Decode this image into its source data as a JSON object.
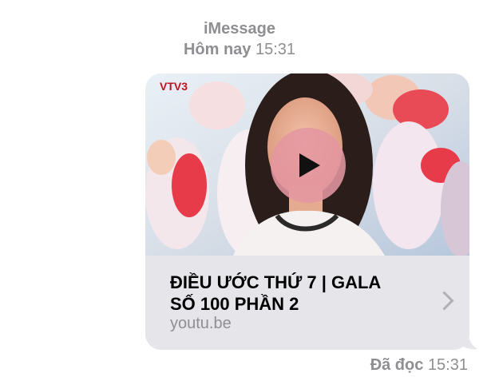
{
  "header": {
    "service": "iMessage",
    "day": "Hôm nay",
    "time": "15:31"
  },
  "link_preview": {
    "channel_logo": "VTV3",
    "title_line1": "ĐIỀU ƯỚC THỨ 7 | GALA",
    "title_line2": "SỐ 100 PHẦN 2",
    "domain": "youtu.be",
    "play_icon": "play-icon",
    "chevron_icon": "chevron-right-icon"
  },
  "receipt": {
    "status": "Đã đọc",
    "time": "15:31"
  },
  "colors": {
    "bubble": "#e5e5ea",
    "secondary_text": "#8e8e93",
    "play_button": "#e496a0"
  }
}
